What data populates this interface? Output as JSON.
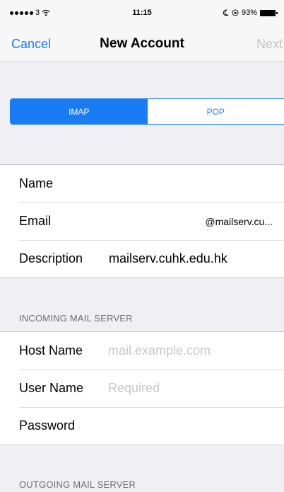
{
  "status_bar": {
    "carrier": "3",
    "time": "11:15",
    "battery": "93%"
  },
  "nav": {
    "cancel": "Cancel",
    "title": "New Account",
    "next": "Next"
  },
  "segments": [
    {
      "label": "IMAP",
      "selected": true
    },
    {
      "label": "POP",
      "selected": false
    }
  ],
  "account": {
    "name_label": "Name",
    "email_label": "Email",
    "email_value": "@mailserv.cu...",
    "description_label": "Description",
    "description_value": "mailserv.cuhk.edu.hk"
  },
  "incoming": {
    "header": "INCOMING MAIL SERVER",
    "host_label": "Host Name",
    "host_placeholder": "mail.example.com",
    "user_label": "User Name",
    "user_placeholder": "Required",
    "password_label": "Password"
  },
  "outgoing": {
    "header": "OUTGOING MAIL SERVER"
  },
  "colors": {
    "accent": "#1a7cf4",
    "background": "#efeff4",
    "placeholder": "#c7c7cd"
  }
}
